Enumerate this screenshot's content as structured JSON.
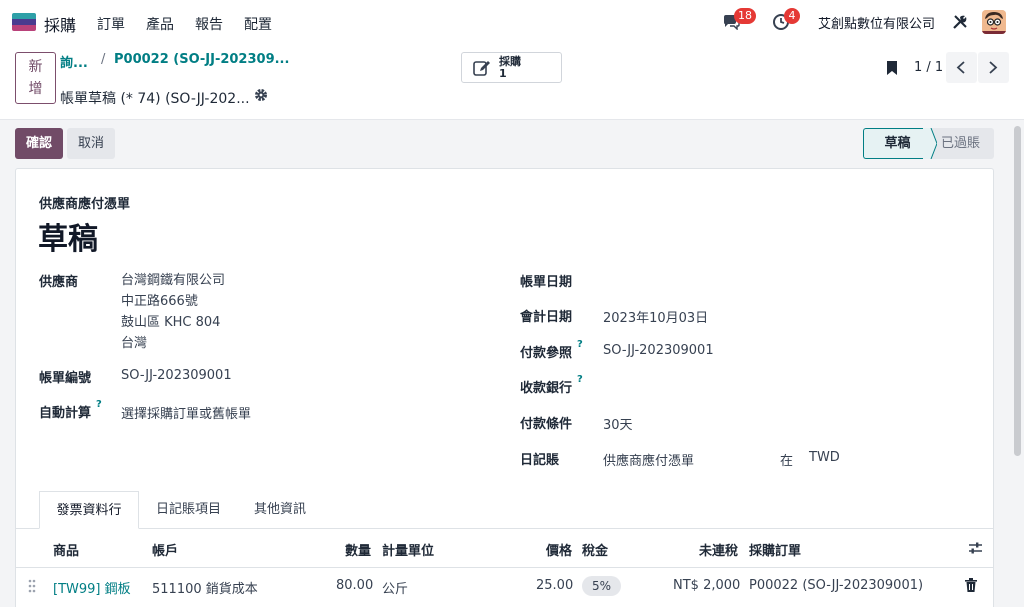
{
  "navbar": {
    "app_name": "採購",
    "menu": [
      "訂單",
      "產品",
      "報告",
      "配置"
    ],
    "messages_count": "18",
    "activities_count": "4",
    "company": "艾創點數位有限公司"
  },
  "control_panel": {
    "new_label_line1": "新",
    "new_label_line2": "增",
    "breadcrumb_1": "詢...",
    "breadcrumb_sep": "/",
    "breadcrumb_2": "P00022 (SO-JJ-202309...",
    "record_title": "帳單草稿 (* 74) (SO-JJ-202...",
    "smart_button_label": "採購",
    "smart_button_value": "1",
    "pager": "1 / 1"
  },
  "actions": {
    "confirm": "確認",
    "cancel": "取消"
  },
  "statusbar": {
    "draft": "草稿",
    "posted": "已過賬"
  },
  "form": {
    "move_type": "供應商應付憑單",
    "state_title": "草稿",
    "left": {
      "vendor_label": "供應商",
      "vendor_name": "台灣鋼鐵有限公司",
      "vendor_street": "中正路666號",
      "vendor_city": "鼓山區 KHC 804",
      "vendor_country": "台灣",
      "bill_ref_label": "帳單編號",
      "bill_ref_value": "SO-JJ-202309001",
      "autocomplete_label": "自動計算",
      "autocomplete_help": "?",
      "autocomplete_placeholder": "選擇採購訂單或舊帳單"
    },
    "right": {
      "bill_date_label": "帳單日期",
      "accounting_date_label": "會計日期",
      "accounting_date_value": "2023年10月03日",
      "payment_ref_label": "付款參照",
      "payment_ref_help": "?",
      "payment_ref_value": "SO-JJ-202309001",
      "bank_label": "收款銀行",
      "bank_help": "?",
      "payment_terms_label": "付款條件",
      "payment_terms_value": "30天",
      "journal_label": "日記賬",
      "journal_value": "供應商應付憑單",
      "journal_in": "在",
      "currency": "TWD"
    }
  },
  "tabs": [
    "發票資料行",
    "日記賬項目",
    "其他資訊"
  ],
  "table": {
    "headers": {
      "product": "商品",
      "account": "帳戶",
      "quantity": "數量",
      "uom": "計量單位",
      "price": "價格",
      "taxes": "稅金",
      "subtotal": "未連稅",
      "purchase_order": "採購訂單"
    },
    "rows": [
      {
        "product": "[TW99] 鋼板",
        "account": "511100 銷貨成本",
        "quantity": "80.00",
        "uom": "公斤",
        "price": "25.00",
        "tax": "5%",
        "subtotal": "NT$ 2,000",
        "purchase_order": "P00022 (SO-JJ-202309001)"
      }
    ]
  },
  "colors": {
    "brand": "#714b67",
    "link": "#017e84",
    "badge": "#e53935"
  }
}
